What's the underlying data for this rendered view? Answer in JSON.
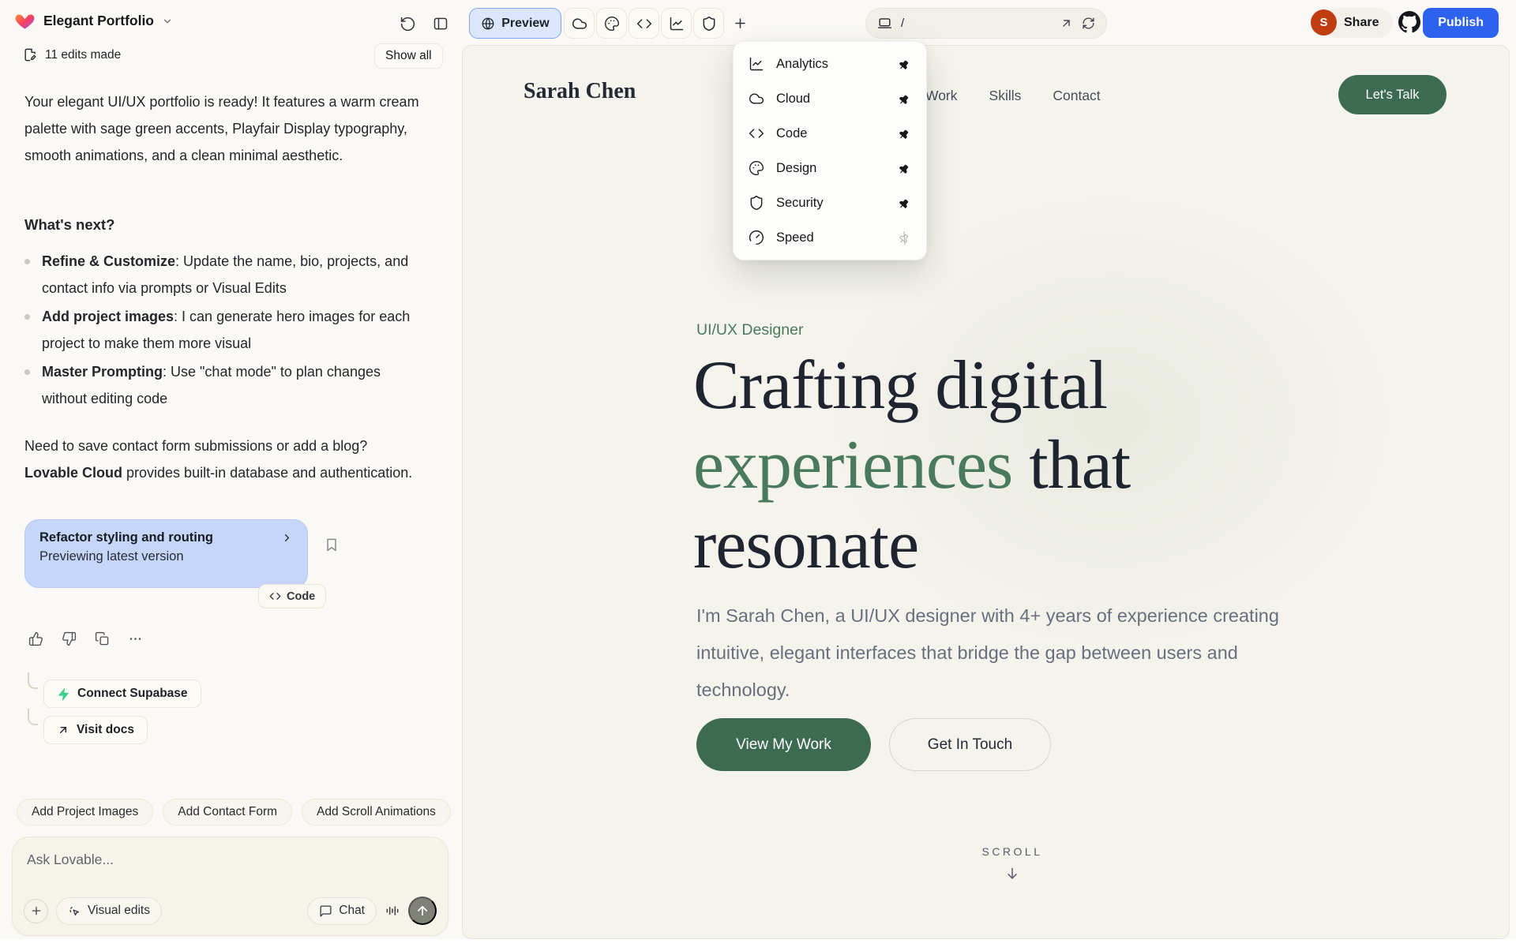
{
  "colors": {
    "app-bg": "#faf9f5",
    "preview-bg": "#f4f3ec",
    "blue": "#2d62ef",
    "blue-light": "#dbe7fc",
    "blue-border": "#7fa6f3",
    "card-blue": "#c6d6f8",
    "green": "#4a7a5e",
    "green-dark": "#3d6b52",
    "hero-ink": "#1e2530",
    "avatar-orange": "#c03d12",
    "supabase-green": "#3ecf8e"
  },
  "topbar": {
    "project_name": "Elegant Portfolio",
    "preview_label": "Preview",
    "url_path": "/",
    "share_label": "Share",
    "publish_label": "Publish",
    "avatar_initial": "S"
  },
  "chat": {
    "edits_summary": "11 edits made",
    "show_all_label": "Show all",
    "intro": "Your elegant UI/UX portfolio is ready! It features a warm cream palette with sage green accents, Playfair Display typography, smooth animations, and a clean minimal aesthetic.",
    "whats_next_heading": "What's next?",
    "bullets": [
      {
        "title": "Refine & Customize",
        "body": ": Update the name, bio, projects, and contact info via prompts or Visual Edits"
      },
      {
        "title": "Add project images",
        "body": ": I can generate hero images for each project to make them more visual"
      },
      {
        "title": "Master Prompting",
        "body": ": Use \"chat mode\" to plan changes without editing code"
      }
    ],
    "cloud_note": {
      "pre": "Need to save contact form submissions or add a blog? ",
      "bold": "Lovable Cloud",
      "post": " provides built-in database and authentication."
    },
    "version_card": {
      "title": "Refactor styling and routing",
      "status": "Previewing latest version",
      "code_chip": "Code"
    },
    "quick_actions": {
      "connect_supabase": "Connect Supabase",
      "visit_docs": "Visit docs"
    },
    "suggestions": [
      "Add Project Images",
      "Add Contact Form",
      "Add Scroll Animations"
    ],
    "composer": {
      "placeholder": "Ask Lovable...",
      "visual_edits": "Visual edits",
      "chat_mode": "Chat"
    }
  },
  "menu": {
    "items": [
      {
        "label": "Analytics",
        "icon": "analytics-icon",
        "pinned": true
      },
      {
        "label": "Cloud",
        "icon": "cloud-icon",
        "pinned": true
      },
      {
        "label": "Code",
        "icon": "code-icon",
        "pinned": true
      },
      {
        "label": "Design",
        "icon": "design-icon",
        "pinned": true
      },
      {
        "label": "Security",
        "icon": "security-icon",
        "pinned": true
      },
      {
        "label": "Speed",
        "icon": "speed-icon",
        "pinned": false
      }
    ]
  },
  "site": {
    "logo": "Sarah Chen",
    "nav": [
      "Work",
      "Skills",
      "Contact"
    ],
    "nav_cta": "Let's Talk",
    "eyebrow": "UI/UX Designer",
    "headline": {
      "line1": "Crafting digital",
      "accent": "experiences",
      "line2_rest": " that",
      "line3": "resonate"
    },
    "bio": "I'm Sarah Chen, a UI/UX designer with 4+ years of experience creating intuitive, elegant interfaces that bridge the gap between users and technology.",
    "primary_cta": "View My Work",
    "secondary_cta": "Get In Touch",
    "scroll_label": "SCROLL"
  }
}
